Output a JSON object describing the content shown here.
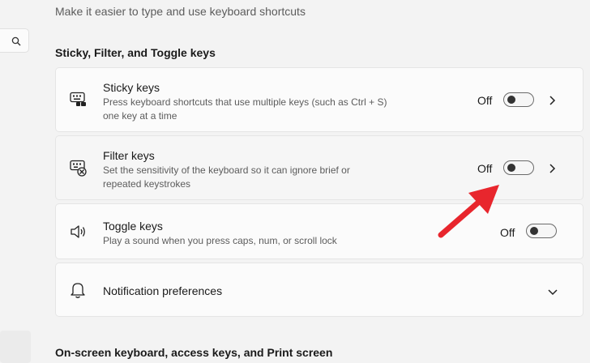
{
  "header": {
    "subtitle": "Make it easier to type and use keyboard shortcuts"
  },
  "sections": {
    "sticky_filter_toggle_title": "Sticky, Filter, and Toggle keys",
    "onscreen_title": "On-screen keyboard, access keys, and Print screen"
  },
  "sticky_keys": {
    "title": "Sticky keys",
    "desc_line1": "Press keyboard shortcuts that use multiple keys (such as Ctrl + S)",
    "desc_line2": "one key at a time",
    "state": "Off",
    "enabled": false
  },
  "filter_keys": {
    "title": "Filter keys",
    "desc_line1": "Set the sensitivity of the keyboard so it can ignore brief or",
    "desc_line2": "repeated keystrokes",
    "state": "Off",
    "enabled": false
  },
  "toggle_keys": {
    "title": "Toggle keys",
    "desc_line1": "Play a sound when you press caps, num, or scroll lock",
    "state": "Off",
    "enabled": false
  },
  "notifications": {
    "title": "Notification preferences"
  },
  "icons": {
    "search": "search-icon",
    "sticky": "sticky-keys-icon",
    "filter": "filter-keys-icon",
    "toggle": "speaker-icon",
    "notification": "bell-icon",
    "chevron_right": "chevron-right-icon",
    "chevron_down": "chevron-down-icon"
  },
  "colors": {
    "annotation_arrow": "#e8262d",
    "background": "#f3f3f3",
    "card": "#fbfbfb"
  }
}
